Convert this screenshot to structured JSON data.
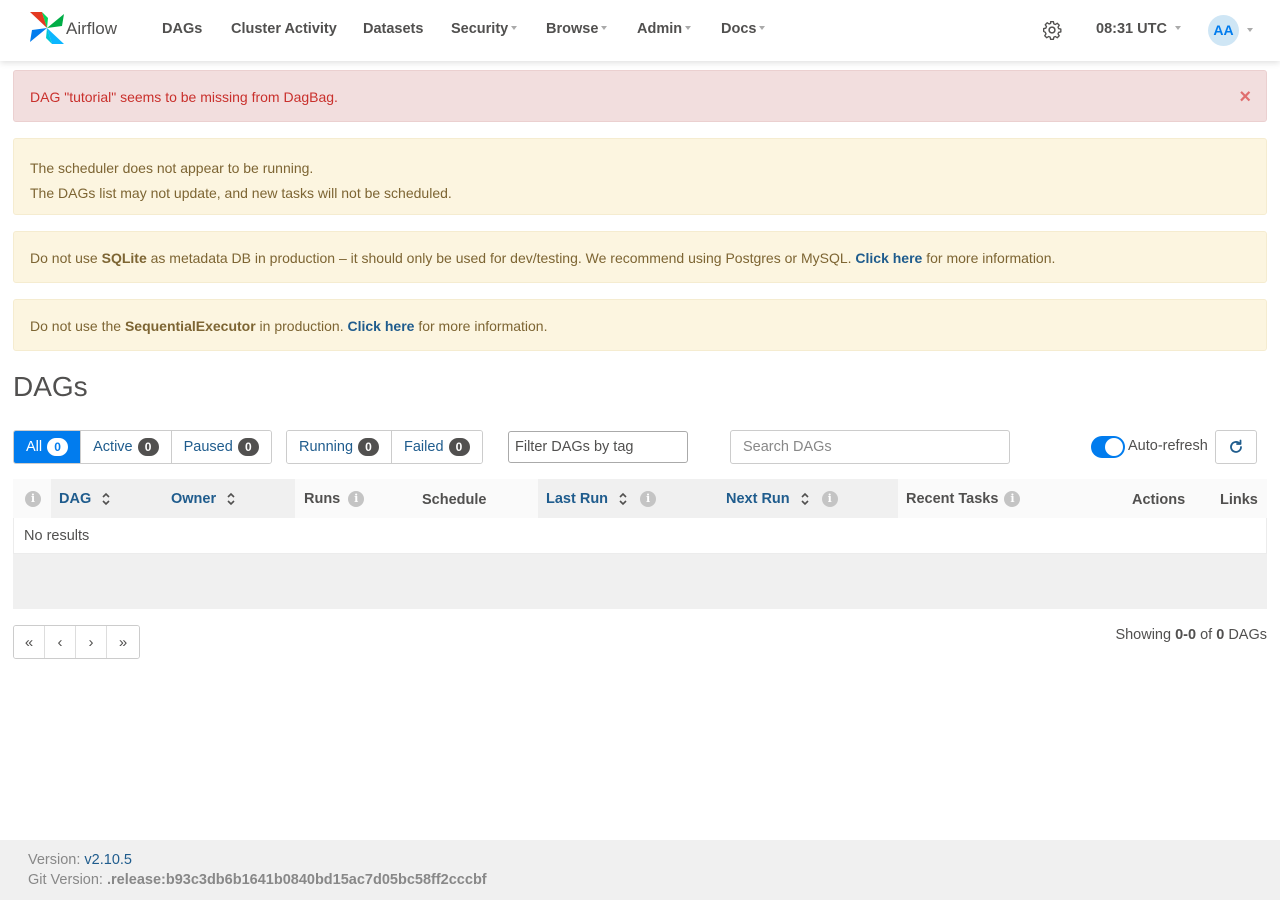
{
  "brand": {
    "name": "Airflow"
  },
  "nav": {
    "items": [
      {
        "label": "DAGs",
        "dropdown": false
      },
      {
        "label": "Cluster Activity",
        "dropdown": false
      },
      {
        "label": "Datasets",
        "dropdown": false
      },
      {
        "label": "Security",
        "dropdown": true
      },
      {
        "label": "Browse",
        "dropdown": true
      },
      {
        "label": "Admin",
        "dropdown": true
      },
      {
        "label": "Docs",
        "dropdown": true
      }
    ],
    "clock": "08:31 UTC",
    "user_initials": "AA",
    "icons": {
      "settings": "gear-icon"
    }
  },
  "alerts": {
    "danger": "DAG \"tutorial\" seems to be missing from DagBag.",
    "scheduler": {
      "line1": "The scheduler does not appear to be running.",
      "line2": "The DAGs list may not update, and new tasks will not be scheduled."
    },
    "sqlite": {
      "prefix": "Do not use ",
      "bold": "SQLite",
      "middle": " as metadata DB in production – it should only be used for dev/testing. We recommend using Postgres or MySQL. ",
      "link": "Click here",
      "suffix": " for more information."
    },
    "executor": {
      "prefix": "Do not use the ",
      "bold": "SequentialExecutor",
      "middle": " in production. ",
      "link": "Click here",
      "suffix": " for more information."
    }
  },
  "page_title": "DAGs",
  "filters": {
    "status": [
      {
        "label": "All",
        "count": "0",
        "active": true
      },
      {
        "label": "Active",
        "count": "0",
        "active": false
      },
      {
        "label": "Paused",
        "count": "0",
        "active": false
      }
    ],
    "run_state": [
      {
        "label": "Running",
        "count": "0"
      },
      {
        "label": "Failed",
        "count": "0"
      }
    ],
    "tag_placeholder": "Filter DAGs by tag",
    "search_placeholder": "Search DAGs",
    "auto_refresh_label": "Auto-refresh",
    "auto_refresh_on": true
  },
  "table": {
    "columns": {
      "dag": "DAG",
      "owner": "Owner",
      "runs": "Runs",
      "schedule": "Schedule",
      "last_run": "Last Run",
      "next_run": "Next Run",
      "recent_tasks": "Recent Tasks",
      "actions": "Actions",
      "links": "Links"
    },
    "empty_text": "No results"
  },
  "pagination": {
    "first": "«",
    "prev": "‹",
    "next": "›",
    "last": "»",
    "showing_prefix": "Showing ",
    "range": "0-0",
    "of": " of ",
    "total": "0",
    "suffix": " DAGs"
  },
  "footer": {
    "version_label": "Version: ",
    "version": "v2.10.5",
    "git_label": "Git Version: ",
    "git_hash": ".release:b93c3db6b1641b0840bd15ac7d05bc58ff2cccbf"
  },
  "colors": {
    "accent": "#017cee",
    "link": "#1f5c8d",
    "danger_bg": "#f2dede",
    "warning_bg": "#fcf5e0"
  }
}
